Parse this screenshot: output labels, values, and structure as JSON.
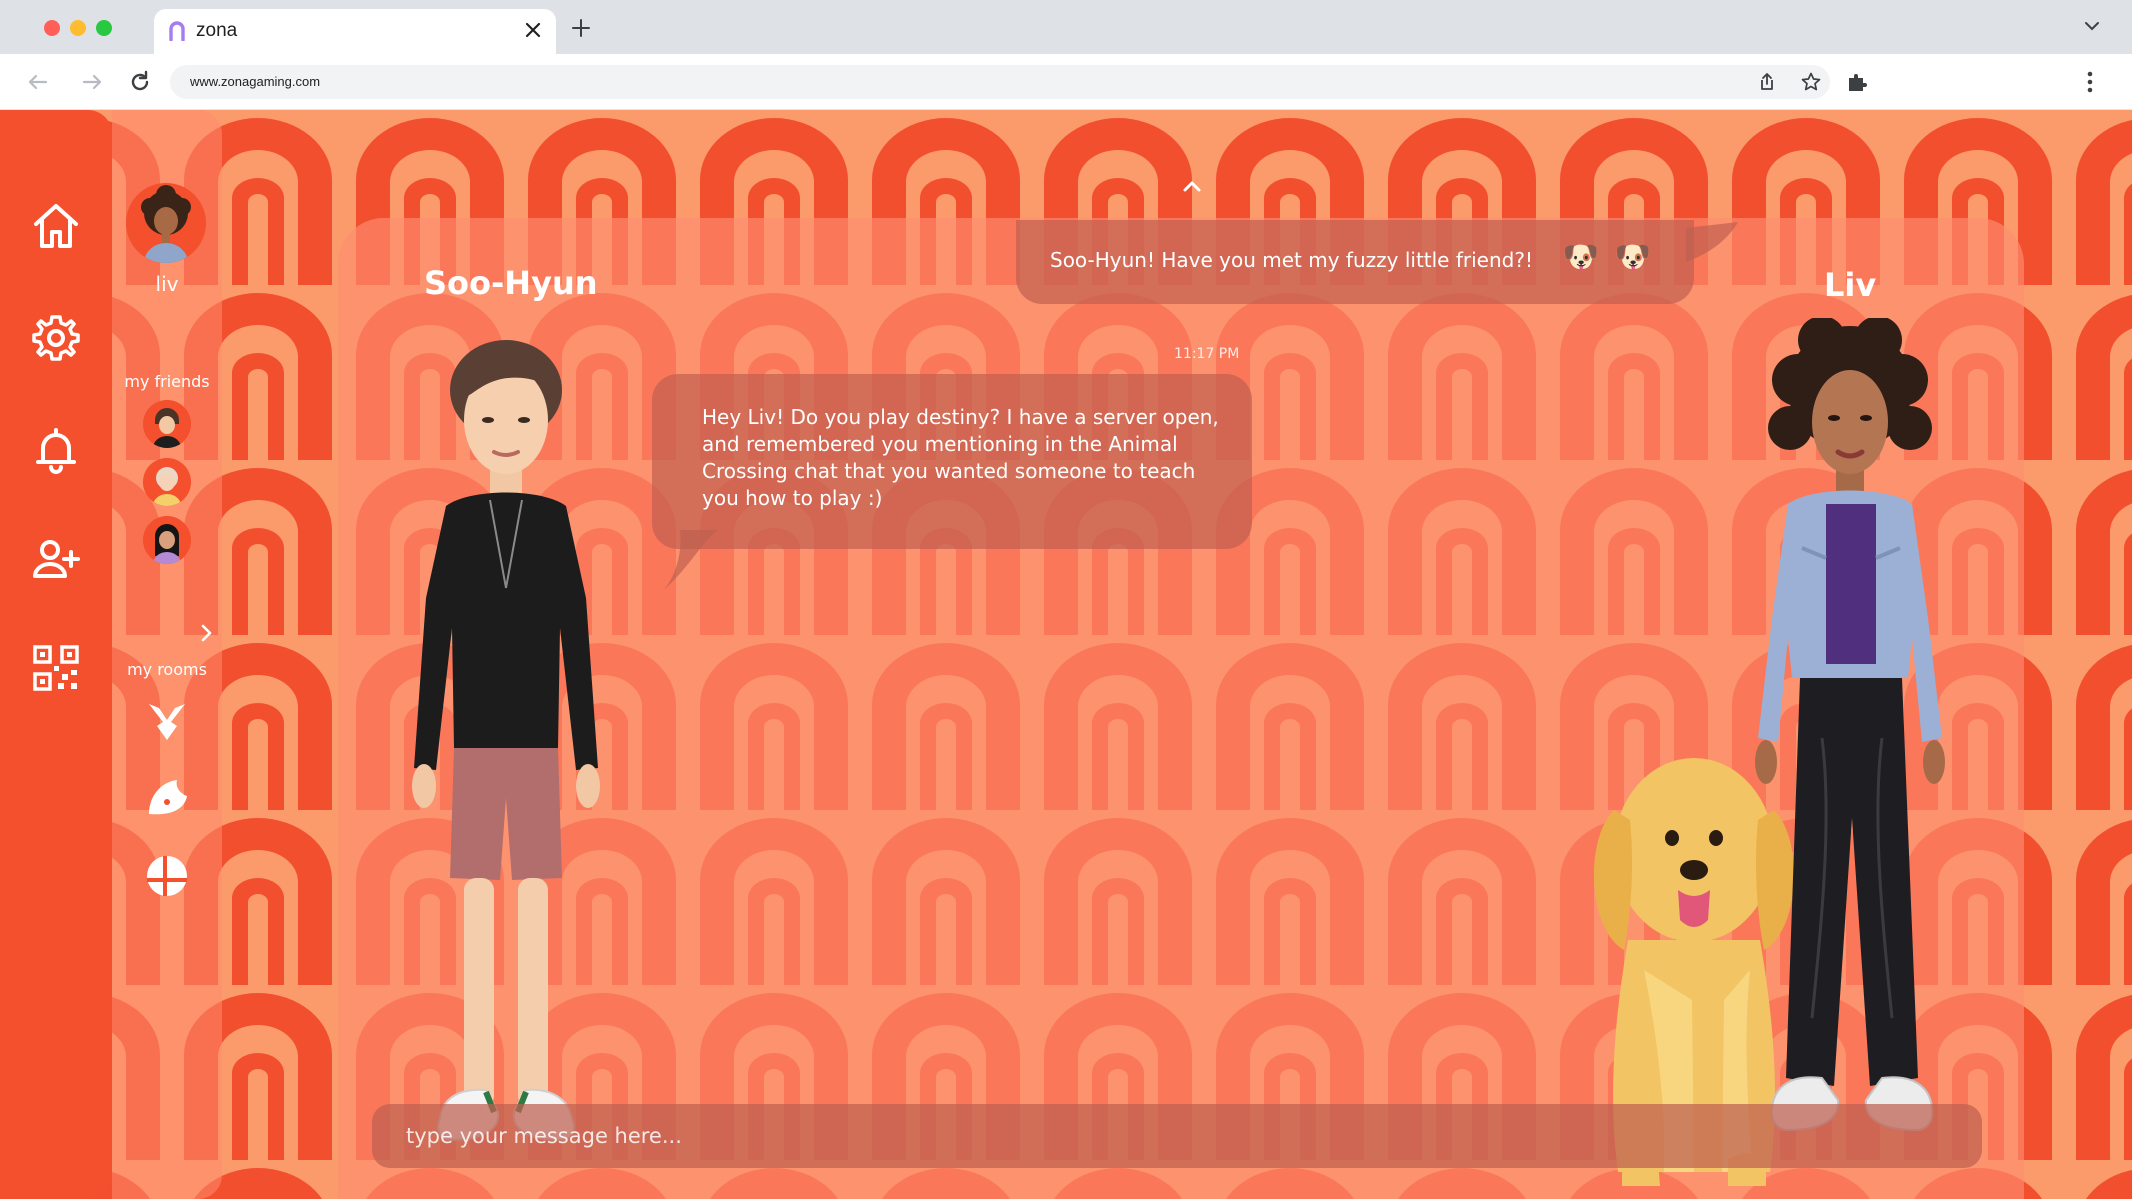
{
  "browser": {
    "tab_title": "zona",
    "url": "www.zonagaming.com",
    "icons": [
      "back-arrow-icon",
      "forward-arrow-icon",
      "reload-icon",
      "share-icon",
      "star-icon",
      "puzzle-extension-icon",
      "kebab-menu-icon",
      "close-icon",
      "plus-icon",
      "chevron-down-icon"
    ]
  },
  "sidebar": {
    "icons": [
      "home-icon",
      "settings-gear-icon",
      "notification-bell-icon",
      "add-friend-icon",
      "qr-code-icon"
    ]
  },
  "profile": {
    "username": "liv"
  },
  "friends": {
    "label": "my friends",
    "avatars": [
      "friend-avatar-1",
      "friend-avatar-2",
      "friend-avatar-3"
    ]
  },
  "rooms": {
    "label": "my rooms",
    "icons": [
      "destiny-room-icon",
      "animal-crossing-room-icon",
      "smash-bros-room-icon"
    ]
  },
  "chat": {
    "left_name": "Soo-Hyun",
    "right_name": "Liv",
    "top_message": "Soo-Hyun! Have you met my fuzzy little friend?!",
    "top_emoji_1": "🐶",
    "top_emoji_2": "🐶",
    "timestamp": "11:17 PM",
    "main_message": "Hey Liv! Do you play destiny? I have a server open, and remembered you mentioning in the Animal Crossing chat that you wanted someone to teach you how to play :)",
    "input_placeholder": "type your message here..."
  },
  "colors": {
    "accent": "#f4502d",
    "background": "#f97a4a",
    "bubble": "#be5f50"
  }
}
